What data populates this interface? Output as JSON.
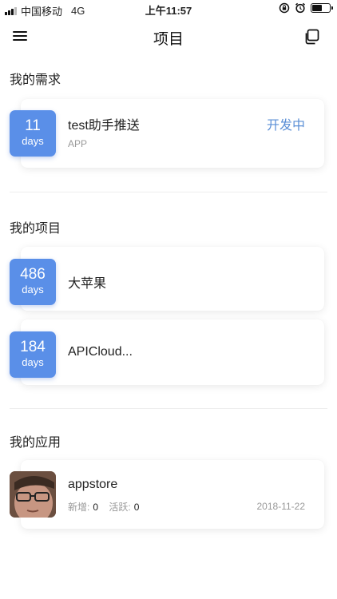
{
  "status_bar": {
    "carrier": "中国移动",
    "network": "4G",
    "time": "上午11:57",
    "battery_level": 0.55
  },
  "nav": {
    "title": "项目",
    "menu_icon": "menu-icon",
    "copy_icon": "copy-icon"
  },
  "sections": {
    "requirements": {
      "title": "我的需求",
      "items": [
        {
          "days": "11",
          "unit": "days",
          "title": "test助手推送",
          "subtitle": "APP",
          "status": "开发中"
        }
      ]
    },
    "projects": {
      "title": "我的项目",
      "items": [
        {
          "days": "486",
          "unit": "days",
          "title": "大苹果"
        },
        {
          "days": "184",
          "unit": "days",
          "title": "APICloud..."
        }
      ]
    },
    "apps": {
      "title": "我的应用",
      "items": [
        {
          "name": "appstore",
          "new_label": "新增:",
          "new_value": "0",
          "active_label": "活跃:",
          "active_value": "0",
          "date": "2018-11-22"
        }
      ]
    }
  },
  "colors": {
    "badge": "#5a8fe8",
    "status": "#5b8fd6"
  }
}
